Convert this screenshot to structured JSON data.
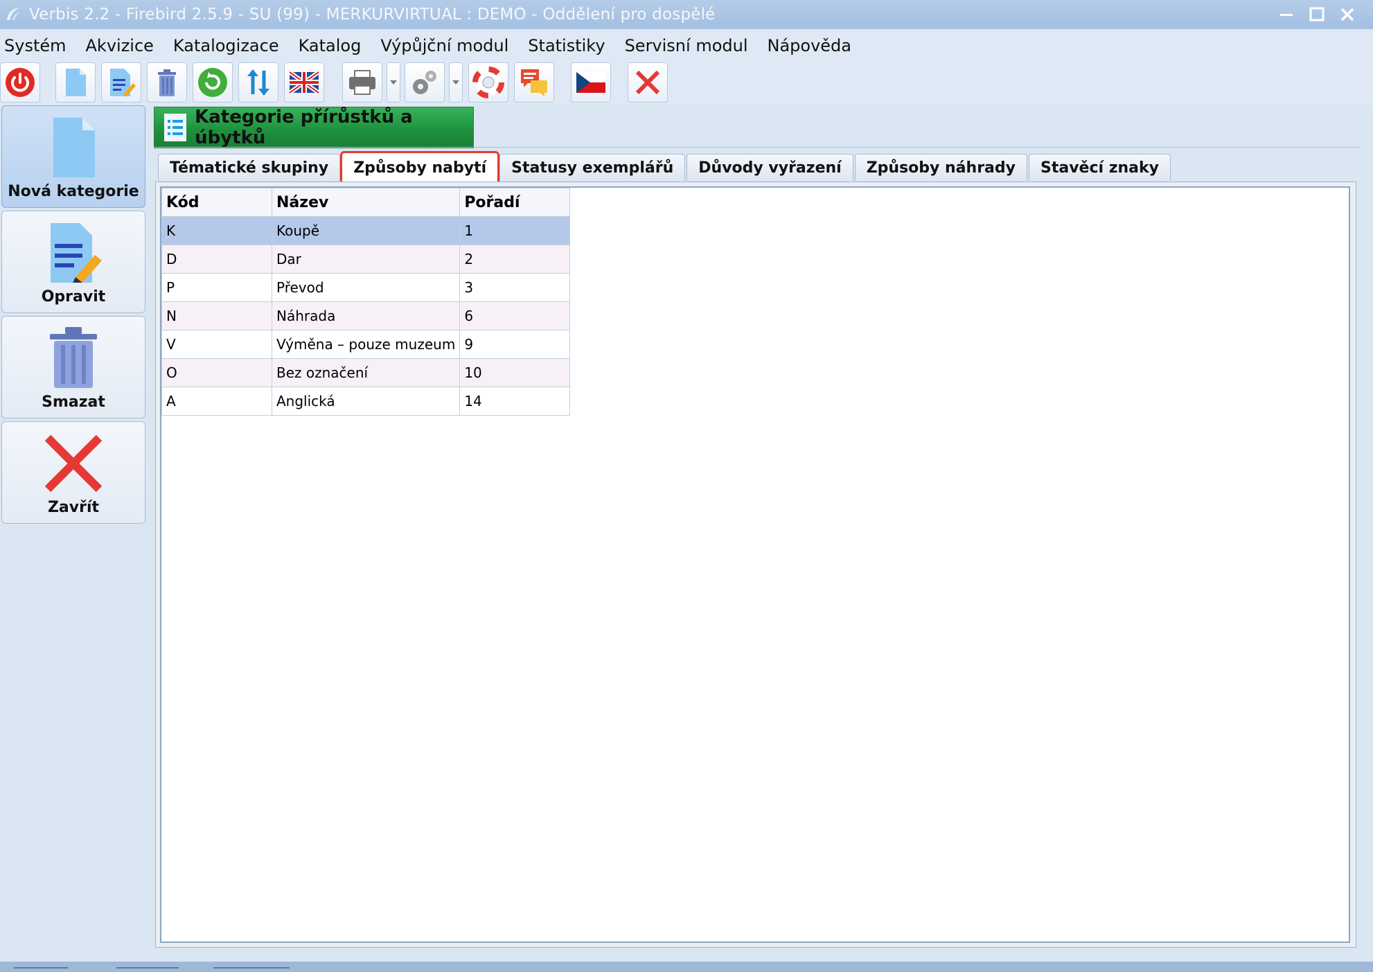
{
  "window": {
    "title": "Verbis 2.2 - Firebird 2.5.9 - SU (99) - MERKURVIRTUAL : DEMO - Oddělení pro dospělé"
  },
  "menu": [
    "Systém",
    "Akvizice",
    "Katalogizace",
    "Katalog",
    "Výpůjční modul",
    "Statistiky",
    "Servisní modul",
    "Nápověda"
  ],
  "toolbar": {
    "icons": [
      "power-icon",
      "new-document-icon",
      "edit-document-icon",
      "trash-icon",
      "refresh-icon",
      "sort-arrows-icon",
      "english-flag-icon",
      "printer-icon",
      "gear-icon",
      "lifebuoy-icon",
      "chat-icon",
      "czech-flag-icon",
      "close-icon"
    ]
  },
  "sidebar": {
    "new_label": "Nová kategorie",
    "edit_label": "Opravit",
    "delete_label": "Smazat",
    "close_label": "Zavřít"
  },
  "window_tab": {
    "title": "Kategorie přírůstků a úbytků"
  },
  "tabs": [
    "Tématické skupiny",
    "Způsoby nabytí",
    "Statusy exemplářů",
    "Důvody vyřazení",
    "Způsoby náhrady",
    "Stavěcí znaky"
  ],
  "selected_tab": "Způsoby nabytí",
  "table": {
    "columns": [
      "Kód",
      "Název",
      "Pořadí"
    ],
    "rows": [
      [
        "K",
        "Koupě",
        "1"
      ],
      [
        "D",
        "Dar",
        "2"
      ],
      [
        "P",
        "Převod",
        "3"
      ],
      [
        "N",
        "Náhrada",
        "6"
      ],
      [
        "V",
        "Výměna – pouze muzeum",
        "9"
      ],
      [
        "O",
        "Bez označení",
        "10"
      ],
      [
        "A",
        "Anglická",
        "14"
      ]
    ],
    "selected_row": 0
  },
  "colors": {
    "highlight_red": "#e23b2e",
    "selection_blue": "#b4c9ea",
    "tab_green": "#1e8f3c"
  }
}
